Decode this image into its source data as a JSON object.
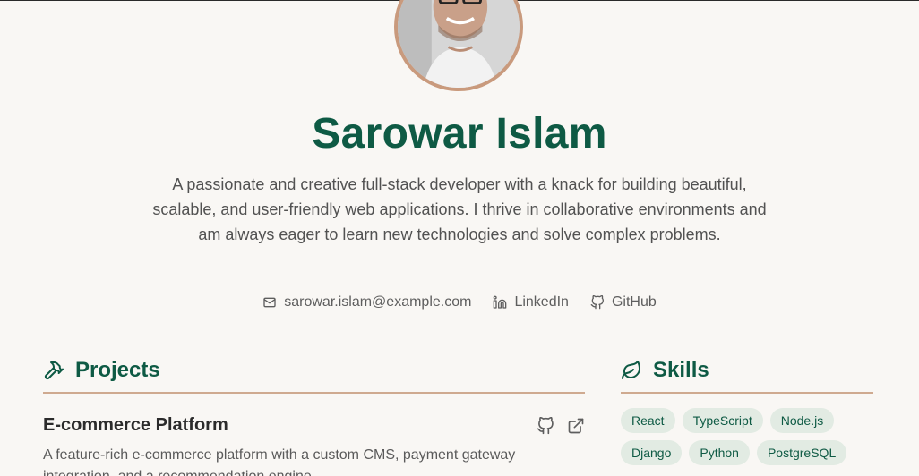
{
  "profile": {
    "name": "Sarowar Islam",
    "bio": "A passionate and creative full-stack developer with a knack for building beautiful, scalable, and user-friendly web applications. I thrive in collaborative environments and am always eager to learn new technologies and solve complex problems."
  },
  "contact": {
    "email": "sarowar.islam@example.com",
    "linkedin": "LinkedIn",
    "github": "GitHub"
  },
  "projects": {
    "title": "Projects",
    "items": [
      {
        "name": "E-commerce Platform",
        "description": "A feature-rich e-commerce platform with a custom CMS, payment gateway integration, and a recommendation engine."
      }
    ]
  },
  "skills": {
    "title": "Skills",
    "items": [
      "React",
      "TypeScript",
      "Node.js",
      "Django",
      "Python",
      "PostgreSQL"
    ]
  },
  "colors": {
    "accent": "#0e5a44",
    "rule": "#cfaa90",
    "chip_bg": "#e2ebe3",
    "background": "#f9f7f4"
  },
  "icons": [
    "mail-icon",
    "linkedin-icon",
    "github-icon",
    "hammer-icon",
    "leaf-icon",
    "external-link-icon"
  ]
}
